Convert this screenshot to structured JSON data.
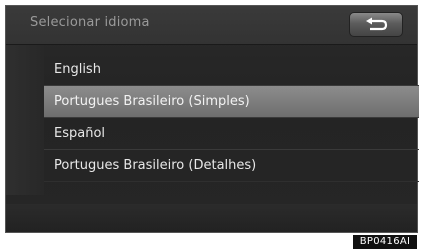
{
  "header": {
    "title": "Selecionar idioma",
    "back_icon": "return-arrow-icon"
  },
  "languages": [
    {
      "label": "English",
      "selected": false
    },
    {
      "label": "Portugues Brasileiro (Simples)",
      "selected": true
    },
    {
      "label": "Español",
      "selected": false
    },
    {
      "label": "Portugues Brasileiro (Detalhes)",
      "selected": false
    }
  ],
  "figure_code": "BP0416AI"
}
